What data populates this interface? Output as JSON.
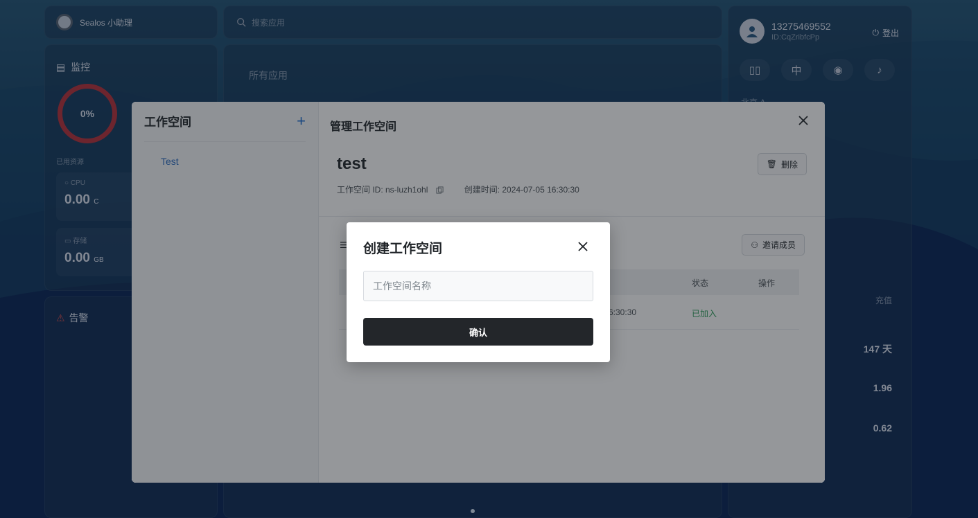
{
  "assistant": {
    "label": "Sealos 小助理"
  },
  "search": {
    "placeholder": "搜索应用"
  },
  "user": {
    "phone": "13275469552",
    "id": "ID:CqZribfcPp",
    "logout": "登出",
    "lang": "中"
  },
  "monitor": {
    "title": "监控",
    "usage_percent_label": "0%",
    "used_resources": "已用资源",
    "cpu": {
      "label": "CPU",
      "value": "0.00",
      "unit": "C"
    },
    "storage": {
      "label": "存储",
      "value": "0.00",
      "unit": "GB"
    }
  },
  "alerts": {
    "title": "告警"
  },
  "apps": {
    "title": "所有应用"
  },
  "right_panel": {
    "recharge": "充值",
    "days": "147 天",
    "balance1": "1.96",
    "balance2": "0.62",
    "region": "北京 A"
  },
  "workspace_modal": {
    "sidebar_title": "工作空间",
    "items": [
      "Test"
    ],
    "header": "管理工作空间",
    "name": "test",
    "id_label": "工作空间 ID: ns-luzh1ohl",
    "created_label": "创建时间: 2024-07-05 16:30:30",
    "delete": "删除",
    "invite": "邀请成员",
    "table": {
      "headers": {
        "status": "状态",
        "action": "操作"
      },
      "rows": [
        {
          "time_fragment": "6:30:30",
          "status": "已加入"
        }
      ]
    }
  },
  "create_dialog": {
    "title": "创建工作空间",
    "input_placeholder": "工作空间名称",
    "confirm": "确认"
  },
  "colors": {
    "accent": "#1f6fd1",
    "success": "#2f9e5b",
    "danger": "#c0393b",
    "button_dark": "#23262a"
  }
}
